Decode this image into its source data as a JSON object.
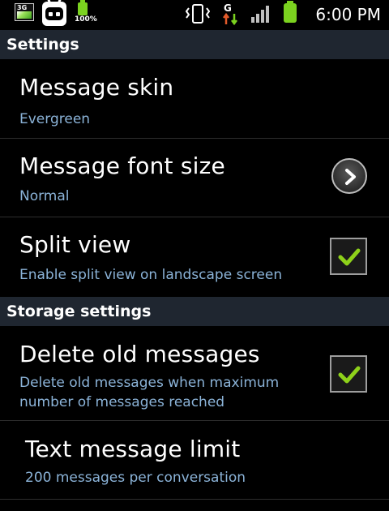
{
  "status_bar": {
    "network_badge": "3G",
    "battery_percent": "100%",
    "time": "6:00 PM",
    "signal_network_letter": "G",
    "accent_battery_color": "#7bd21f"
  },
  "sections": {
    "settings": "Settings",
    "storage": "Storage settings"
  },
  "preferences": {
    "message_skin": {
      "title": "Message skin",
      "summary": "Evergreen"
    },
    "message_font_size": {
      "title": "Message font size",
      "summary": "Normal",
      "icon": "chevron-right-icon"
    },
    "split_view": {
      "title": "Split view",
      "summary": "Enable split view on landscape screen",
      "checked": true
    },
    "delete_old_messages": {
      "title": "Delete old messages",
      "summary": "Delete old messages when maximum number of messages reached",
      "checked": true
    },
    "text_message_limit": {
      "title": "Text message limit",
      "summary": "200 messages per conversation"
    }
  },
  "colors": {
    "background": "#000000",
    "section_header_bg": "#1f2630",
    "summary_text": "#8bb3d8",
    "check_green": "#8ed11a"
  }
}
